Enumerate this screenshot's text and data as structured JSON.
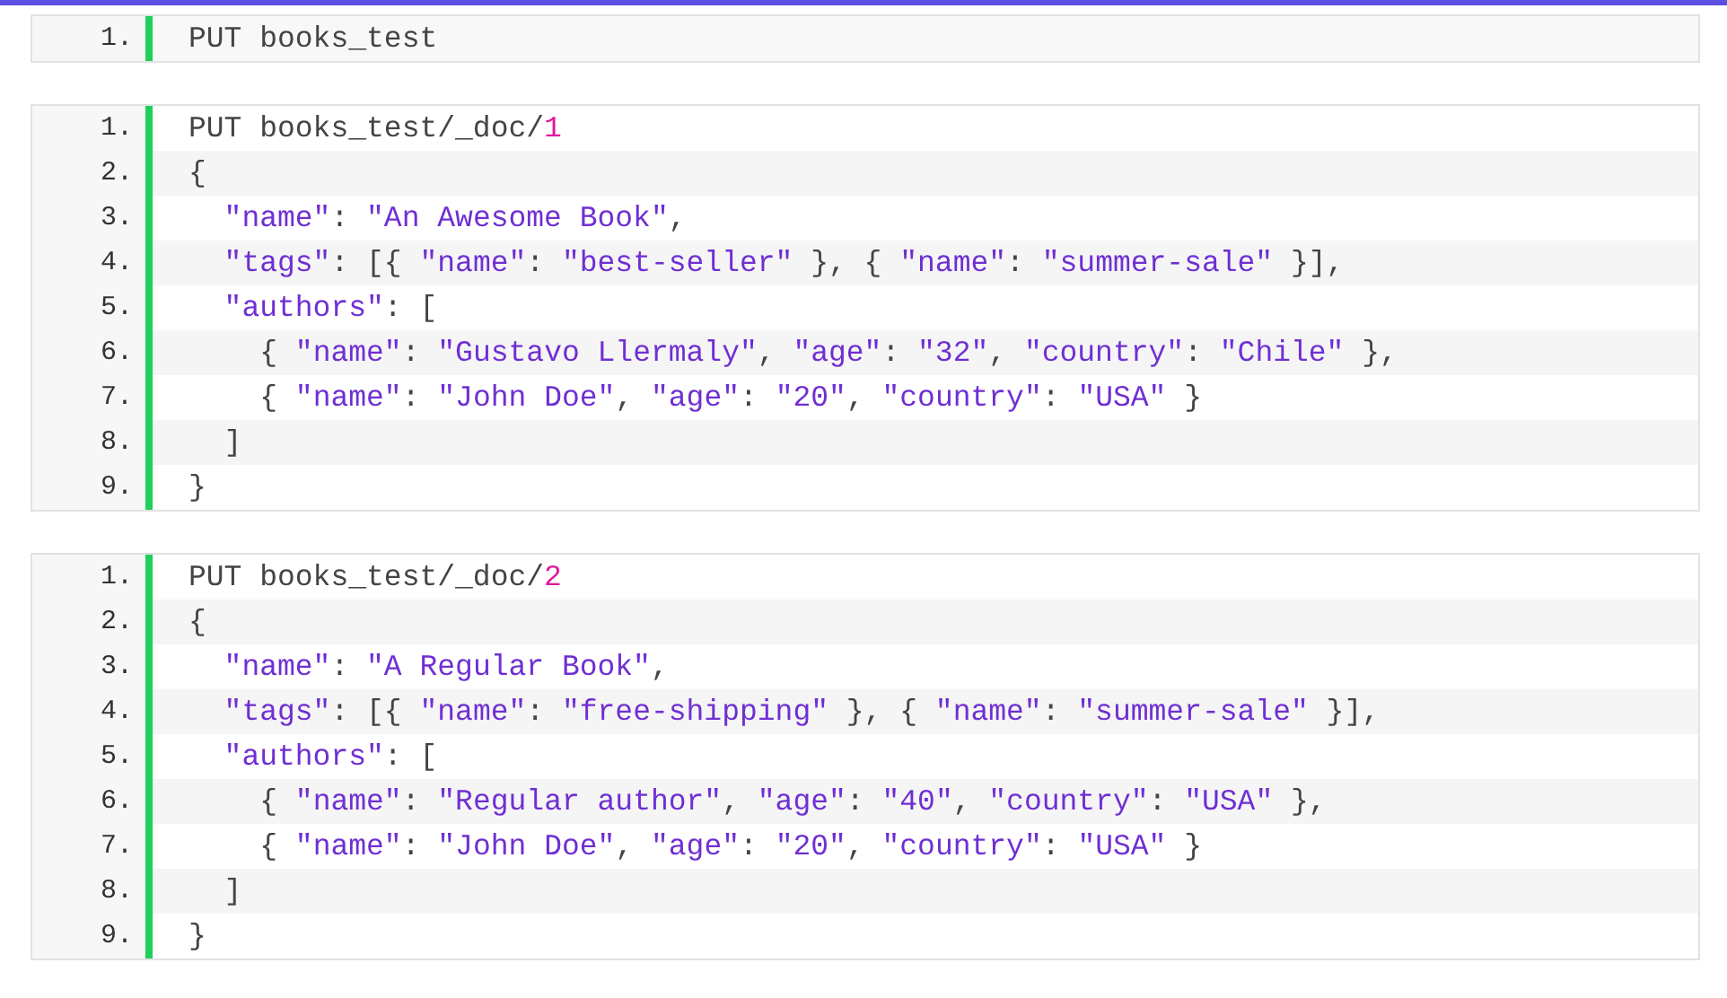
{
  "code_blocks": [
    {
      "lines": [
        {
          "number": "1.",
          "tokens": [
            {
              "kind": "plain",
              "text": "PUT books_test"
            }
          ]
        }
      ]
    },
    {
      "lines": [
        {
          "number": "1.",
          "tokens": [
            {
              "kind": "plain",
              "text": "PUT books_test/_doc/"
            },
            {
              "kind": "number",
              "text": "1"
            }
          ]
        },
        {
          "number": "2.",
          "tokens": [
            {
              "kind": "plain",
              "text": "{"
            }
          ]
        },
        {
          "number": "3.",
          "tokens": [
            {
              "kind": "string",
              "text": "  \"name\""
            },
            {
              "kind": "plain",
              "text": ": "
            },
            {
              "kind": "string",
              "text": "\"An Awesome Book\""
            },
            {
              "kind": "plain",
              "text": ","
            }
          ]
        },
        {
          "number": "4.",
          "tokens": [
            {
              "kind": "string",
              "text": "  \"tags\""
            },
            {
              "kind": "plain",
              "text": ": [{ "
            },
            {
              "kind": "string",
              "text": "\"name\""
            },
            {
              "kind": "plain",
              "text": ": "
            },
            {
              "kind": "string",
              "text": "\"best-seller\""
            },
            {
              "kind": "plain",
              "text": " }, { "
            },
            {
              "kind": "string",
              "text": "\"name\""
            },
            {
              "kind": "plain",
              "text": ": "
            },
            {
              "kind": "string",
              "text": "\"summer-sale\""
            },
            {
              "kind": "plain",
              "text": " }],"
            }
          ]
        },
        {
          "number": "5.",
          "tokens": [
            {
              "kind": "string",
              "text": "  \"authors\""
            },
            {
              "kind": "plain",
              "text": ": ["
            }
          ]
        },
        {
          "number": "6.",
          "tokens": [
            {
              "kind": "plain",
              "text": "    { "
            },
            {
              "kind": "string",
              "text": "\"name\""
            },
            {
              "kind": "plain",
              "text": ": "
            },
            {
              "kind": "string",
              "text": "\"Gustavo Llermaly\""
            },
            {
              "kind": "plain",
              "text": ", "
            },
            {
              "kind": "string",
              "text": "\"age\""
            },
            {
              "kind": "plain",
              "text": ": "
            },
            {
              "kind": "string",
              "text": "\"32\""
            },
            {
              "kind": "plain",
              "text": ", "
            },
            {
              "kind": "string",
              "text": "\"country\""
            },
            {
              "kind": "plain",
              "text": ": "
            },
            {
              "kind": "string",
              "text": "\"Chile\""
            },
            {
              "kind": "plain",
              "text": " },"
            }
          ]
        },
        {
          "number": "7.",
          "tokens": [
            {
              "kind": "plain",
              "text": "    { "
            },
            {
              "kind": "string",
              "text": "\"name\""
            },
            {
              "kind": "plain",
              "text": ": "
            },
            {
              "kind": "string",
              "text": "\"John Doe\""
            },
            {
              "kind": "plain",
              "text": ", "
            },
            {
              "kind": "string",
              "text": "\"age\""
            },
            {
              "kind": "plain",
              "text": ": "
            },
            {
              "kind": "string",
              "text": "\"20\""
            },
            {
              "kind": "plain",
              "text": ", "
            },
            {
              "kind": "string",
              "text": "\"country\""
            },
            {
              "kind": "plain",
              "text": ": "
            },
            {
              "kind": "string",
              "text": "\"USA\""
            },
            {
              "kind": "plain",
              "text": " }"
            }
          ]
        },
        {
          "number": "8.",
          "tokens": [
            {
              "kind": "plain",
              "text": "  ]"
            }
          ]
        },
        {
          "number": "9.",
          "tokens": [
            {
              "kind": "plain",
              "text": "}"
            }
          ]
        }
      ]
    },
    {
      "lines": [
        {
          "number": "1.",
          "tokens": [
            {
              "kind": "plain",
              "text": "PUT books_test/_doc/"
            },
            {
              "kind": "number",
              "text": "2"
            }
          ]
        },
        {
          "number": "2.",
          "tokens": [
            {
              "kind": "plain",
              "text": "{"
            }
          ]
        },
        {
          "number": "3.",
          "tokens": [
            {
              "kind": "string",
              "text": "  \"name\""
            },
            {
              "kind": "plain",
              "text": ": "
            },
            {
              "kind": "string",
              "text": "\"A Regular Book\""
            },
            {
              "kind": "plain",
              "text": ","
            }
          ]
        },
        {
          "number": "4.",
          "tokens": [
            {
              "kind": "string",
              "text": "  \"tags\""
            },
            {
              "kind": "plain",
              "text": ": [{ "
            },
            {
              "kind": "string",
              "text": "\"name\""
            },
            {
              "kind": "plain",
              "text": ": "
            },
            {
              "kind": "string",
              "text": "\"free-shipping\""
            },
            {
              "kind": "plain",
              "text": " }, { "
            },
            {
              "kind": "string",
              "text": "\"name\""
            },
            {
              "kind": "plain",
              "text": ": "
            },
            {
              "kind": "string",
              "text": "\"summer-sale\""
            },
            {
              "kind": "plain",
              "text": " }],"
            }
          ]
        },
        {
          "number": "5.",
          "tokens": [
            {
              "kind": "string",
              "text": "  \"authors\""
            },
            {
              "kind": "plain",
              "text": ": ["
            }
          ]
        },
        {
          "number": "6.",
          "tokens": [
            {
              "kind": "plain",
              "text": "    { "
            },
            {
              "kind": "string",
              "text": "\"name\""
            },
            {
              "kind": "plain",
              "text": ": "
            },
            {
              "kind": "string",
              "text": "\"Regular author\""
            },
            {
              "kind": "plain",
              "text": ", "
            },
            {
              "kind": "string",
              "text": "\"age\""
            },
            {
              "kind": "plain",
              "text": ": "
            },
            {
              "kind": "string",
              "text": "\"40\""
            },
            {
              "kind": "plain",
              "text": ", "
            },
            {
              "kind": "string",
              "text": "\"country\""
            },
            {
              "kind": "plain",
              "text": ": "
            },
            {
              "kind": "string",
              "text": "\"USA\""
            },
            {
              "kind": "plain",
              "text": " },"
            }
          ]
        },
        {
          "number": "7.",
          "tokens": [
            {
              "kind": "plain",
              "text": "    { "
            },
            {
              "kind": "string",
              "text": "\"name\""
            },
            {
              "kind": "plain",
              "text": ": "
            },
            {
              "kind": "string",
              "text": "\"John Doe\""
            },
            {
              "kind": "plain",
              "text": ", "
            },
            {
              "kind": "string",
              "text": "\"age\""
            },
            {
              "kind": "plain",
              "text": ": "
            },
            {
              "kind": "string",
              "text": "\"20\""
            },
            {
              "kind": "plain",
              "text": ", "
            },
            {
              "kind": "string",
              "text": "\"country\""
            },
            {
              "kind": "plain",
              "text": ": "
            },
            {
              "kind": "string",
              "text": "\"USA\""
            },
            {
              "kind": "plain",
              "text": " }"
            }
          ]
        },
        {
          "number": "8.",
          "tokens": [
            {
              "kind": "plain",
              "text": "  ]"
            }
          ]
        },
        {
          "number": "9.",
          "tokens": [
            {
              "kind": "plain",
              "text": "}"
            }
          ]
        }
      ]
    }
  ]
}
